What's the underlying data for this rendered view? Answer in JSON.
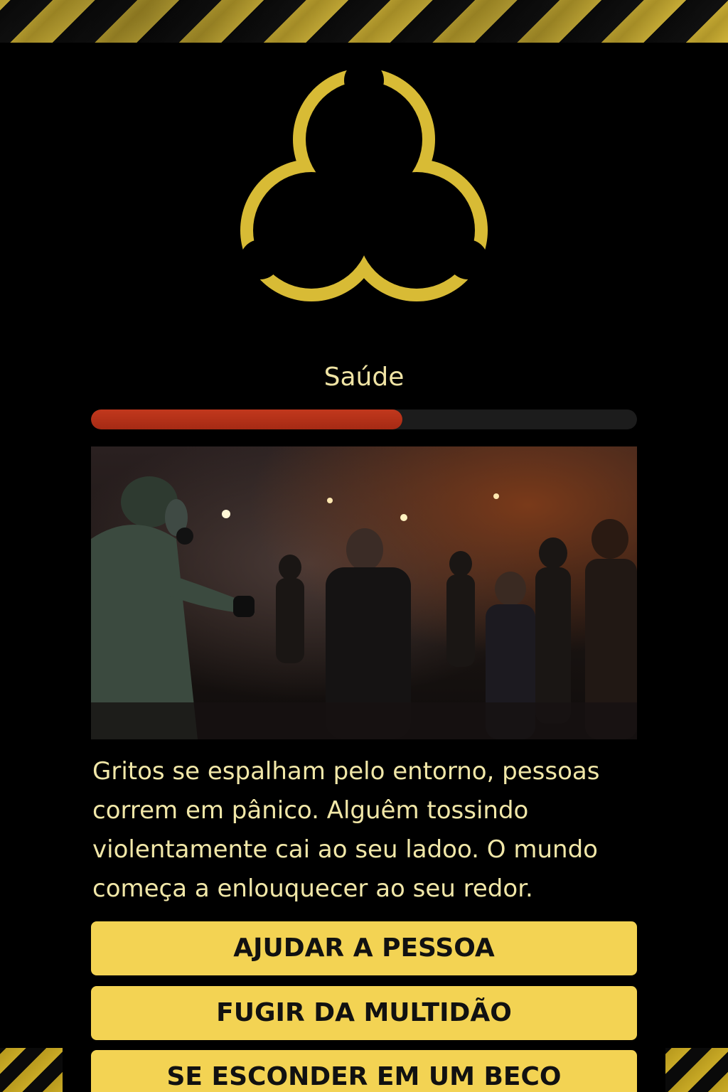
{
  "health": {
    "label": "Saúde",
    "value_fraction": 0.57
  },
  "story": {
    "text": "Gritos se espalham pelo entorno, pessoas correm em pânico. Alguêm tossindo violentamente cai ao seu ladoo. O mundo começa a enlouquecer ao seu redor."
  },
  "choices": [
    {
      "label": "AJUDAR A PESSOA"
    },
    {
      "label": "FUGIR DA MULTIDÃO"
    },
    {
      "label": "SE ESCONDER EM UM BECO"
    }
  ],
  "icons": {
    "emblem": "biohazard-icon"
  },
  "colors": {
    "accent_yellow": "#f3d353",
    "emblem_yellow": "#d8bb35",
    "health_red": "#b83019",
    "text": "#f1e7a8"
  }
}
